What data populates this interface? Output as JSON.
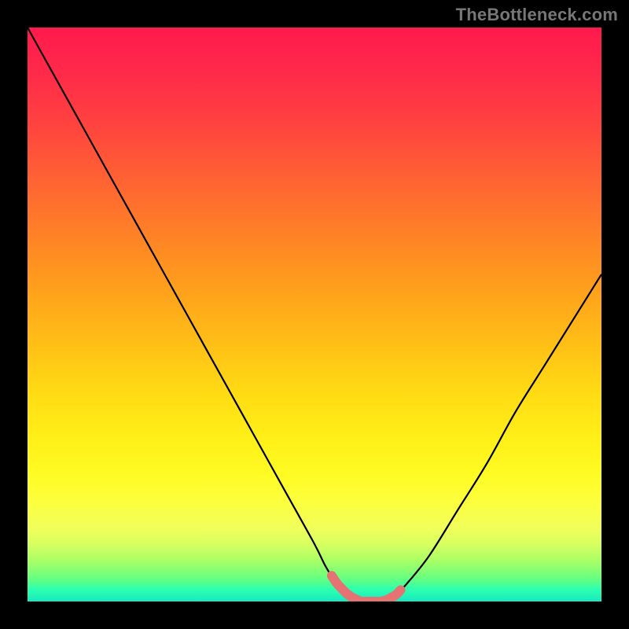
{
  "attribution": "TheBottleneck.com",
  "colors": {
    "page_bg": "#000000",
    "curve": "#000000",
    "highlight_stroke": "#e57373",
    "attribution_text": "#777777"
  },
  "chart_data": {
    "type": "line",
    "title": "",
    "xlabel": "",
    "ylabel": "",
    "xlim": [
      0,
      100
    ],
    "ylim": [
      0,
      100
    ],
    "grid": false,
    "x": [
      0,
      5,
      10,
      15,
      20,
      25,
      30,
      35,
      40,
      45,
      50,
      52,
      54,
      56,
      58,
      60,
      62,
      64,
      66,
      70,
      75,
      80,
      85,
      90,
      95,
      100
    ],
    "values": [
      100,
      91,
      82,
      73,
      64,
      55,
      46,
      37,
      28,
      19,
      10,
      6,
      3,
      1,
      0,
      0,
      0,
      1,
      3,
      8,
      16,
      24,
      33,
      41,
      49,
      57
    ],
    "highlight_range_x": [
      53,
      65
    ],
    "annotations": []
  }
}
